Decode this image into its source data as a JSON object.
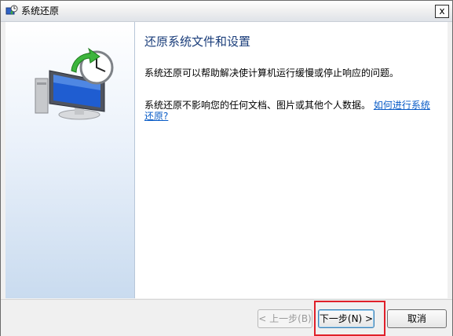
{
  "window": {
    "title": "系统还原",
    "close_label": "x"
  },
  "main": {
    "heading": "还原系统文件和设置",
    "para1": "系统还原可以帮助解决使计算机运行缓慢或停止响应的问题。",
    "para2_text": "系统还原不影响您的任何文档、图片或其他个人数据。",
    "para2_link": "如何进行系统还原?"
  },
  "footer": {
    "prev_label": "< 上一步(B)",
    "next_label": "下一步(N) >",
    "cancel_label": "取消"
  },
  "colors": {
    "accent": "#1a3d7a",
    "link": "#0a5cc7",
    "highlight": "#e0202a"
  }
}
